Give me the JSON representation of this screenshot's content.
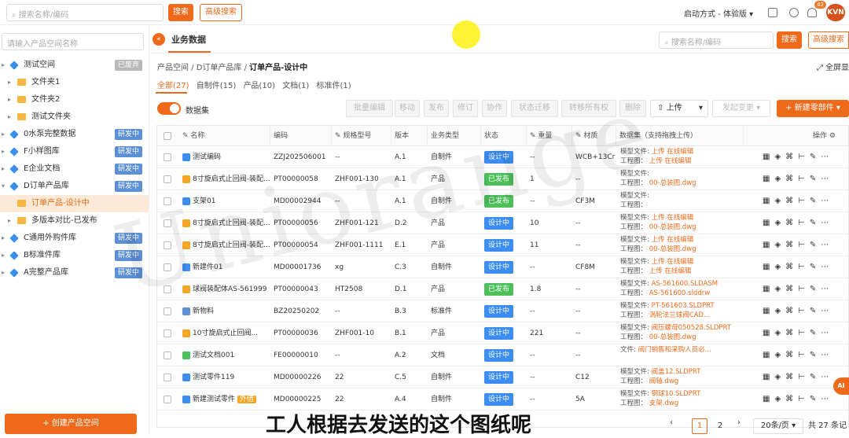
{
  "top": {
    "search_placeholder": "搜索名称/编码",
    "search_btn": "搜索",
    "adv_btn": "高级搜索",
    "mode": "启动方式 - 体验版",
    "notif_count": "42",
    "avatar": "KVN"
  },
  "sidebar": {
    "search_placeholder": "请输入产品空间名称",
    "create_btn": "创建产品空间",
    "items": [
      {
        "label": "测试空间",
        "tag": "已废弃"
      },
      {
        "label": "文件夹1"
      },
      {
        "label": "文件夹2"
      },
      {
        "label": "测试文件夹"
      },
      {
        "label": "0水泵完整数据",
        "tag": "研发中"
      },
      {
        "label": "F小样图库",
        "tag": "研发中"
      },
      {
        "label": "E企业文档",
        "tag": "研发中"
      },
      {
        "label": "D订单产品库",
        "tag": "研发中"
      },
      {
        "label": "订单产品-设计中"
      },
      {
        "label": "多版本对比-已发布"
      },
      {
        "label": "C通用外购件库",
        "tag": "研发中"
      },
      {
        "label": "B标准件库",
        "tag": "研发中"
      },
      {
        "label": "A完整产品库",
        "tag": "研发中"
      }
    ]
  },
  "main": {
    "tab": "业务数据",
    "search_placeholder": "搜索名称/编码",
    "search_btn": "搜索",
    "adv_btn": "高级搜索",
    "crumb_prefix": "产品空间 / D订单产品库 / ",
    "crumb_current": "订单产品-设计中",
    "fullscreen": "全屏显",
    "filters": [
      "全部(27)",
      "自制件(15)",
      "产品(10)",
      "文档(1)",
      "标准件(1)"
    ],
    "dataset_label": "数据集",
    "toolbar": [
      "批量编辑",
      "移动",
      "发布",
      "修订",
      "协作",
      "状态迁移",
      "转移所有权",
      "删除"
    ],
    "upload": "上传",
    "change": "发起变更",
    "new_part": "新建零部件"
  },
  "table": {
    "headers": [
      "名称",
      "编码",
      "规格型号",
      "版本",
      "业务类型",
      "状态",
      "重量",
      "材质",
      "数据集（支持拖拽上传）",
      "操作"
    ],
    "rows": [
      {
        "name": "测试编码",
        "code": "ZZJ202506001",
        "spec": "--",
        "ver": "A.1",
        "type": "自制件",
        "status": "设计中",
        "weight": "--",
        "mat": "WCB+13Cr",
        "d1": "模型文件:",
        "d1v": "上传  在线编辑",
        "d2": "工程图：",
        "d2v": "上传  在线编辑"
      },
      {
        "name": "8寸旋启式止回阀-装配...",
        "code": "PT00000058",
        "spec": "ZHF001-130",
        "ver": "A.1",
        "type": "产品",
        "status": "已发布",
        "weight": "1",
        "mat": "--",
        "d1": "模型文件:",
        "d1v": "",
        "d2": "工程图：",
        "d2v": "00-总装图.dwg"
      },
      {
        "name": "支架01",
        "code": "MD00002944",
        "spec": "--",
        "ver": "A.1",
        "type": "自制件",
        "status": "已发布",
        "weight": "--",
        "mat": "CF3M",
        "d1": "模型文件:",
        "d1v": "",
        "d2": "工程图：",
        "d2v": ""
      },
      {
        "name": "8寸旋启式止回阀-装配...",
        "code": "PT00000056",
        "spec": "ZHF001-121",
        "ver": "D.2",
        "type": "产品",
        "status": "设计中",
        "weight": "10",
        "mat": "--",
        "d1": "模型文件:",
        "d1v": "上传  在线编辑",
        "d2": "工程图：",
        "d2v": "00-总装图.dwg"
      },
      {
        "name": "8寸旋启式止回阀-装配...",
        "code": "PT00000054",
        "spec": "ZHF001-1111",
        "ver": "E.1",
        "type": "产品",
        "status": "设计中",
        "weight": "11",
        "mat": "--",
        "d1": "模型文件:",
        "d1v": "上传  在线编辑",
        "d2": "工程图：",
        "d2v": "00-总装图.dwg"
      },
      {
        "name": "新建件01",
        "code": "MD00001736",
        "spec": "xg",
        "ver": "C.3",
        "type": "自制件",
        "status": "设计中",
        "weight": "--",
        "mat": "CF8M",
        "d1": "模型文件:",
        "d1v": "上传  在线编辑",
        "d2": "工程图：",
        "d2v": "上传  在线编辑"
      },
      {
        "name": "球阀装配体AS-561999",
        "code": "PT00000043",
        "spec": "HT2508",
        "ver": "D.1",
        "type": "产品",
        "status": "已发布",
        "weight": "1.8",
        "mat": "--",
        "d1": "模型文件:",
        "d1v": "AS-561600.SLDASM",
        "d2": "工程图：",
        "d2v": "AS-561600.slddrw"
      },
      {
        "name": "新物料",
        "code": "BZ20250202",
        "spec": "--",
        "ver": "B.3",
        "type": "标准件",
        "status": "设计中",
        "weight": "--",
        "mat": "--",
        "d1": "模型文件:",
        "d1v": "PT-561603.SLDPRT",
        "d2": "工程图：",
        "d2v": "涡轮法兰球阀CAD..."
      },
      {
        "name": "10寸旋启式止回阀...",
        "code": "PT00000036",
        "spec": "ZHF001-10",
        "ver": "B.1",
        "type": "产品",
        "status": "设计中",
        "weight": "221",
        "mat": "--",
        "d1": "模型文件:",
        "d1v": "阀压螺母050528.SLDPRT",
        "d2": "工程图：",
        "d2v": "00-总装图.dwg"
      },
      {
        "name": "测试文档001",
        "code": "FE00000010",
        "spec": "--",
        "ver": "A.2",
        "type": "文档",
        "status": "设计中",
        "weight": "--",
        "mat": "--",
        "d1": "文件:",
        "d1v": "阀门销售和采购人员必...",
        "d2": "",
        "d2v": ""
      },
      {
        "name": "测试零件119",
        "code": "MD00000226",
        "spec": "22",
        "ver": "C.5",
        "type": "自制件",
        "status": "设计中",
        "weight": "--",
        "mat": "C12",
        "d1": "模型文件:",
        "d1v": "阀盖12.SLDPRT",
        "d2": "工程图：",
        "d2v": "阀轴.dwg"
      },
      {
        "name": "新建测试零件",
        "code": "MD00000225",
        "spec": "22",
        "ver": "A.4",
        "type": "自制件",
        "status": "设计中",
        "weight": "--",
        "mat": "5A",
        "d1": "模型文件:",
        "d1v": "钢球10.SLDPRT",
        "d2": "工程图：",
        "d2v": "支架.dwg"
      }
    ],
    "outsource_tag": "外借"
  },
  "pager": {
    "pages": [
      "1",
      "2"
    ],
    "size": "20条/页",
    "total": "共 27 条记"
  },
  "subtitle": "工人根据去发送的这个图纸呢",
  "watermark": "Uniorange"
}
